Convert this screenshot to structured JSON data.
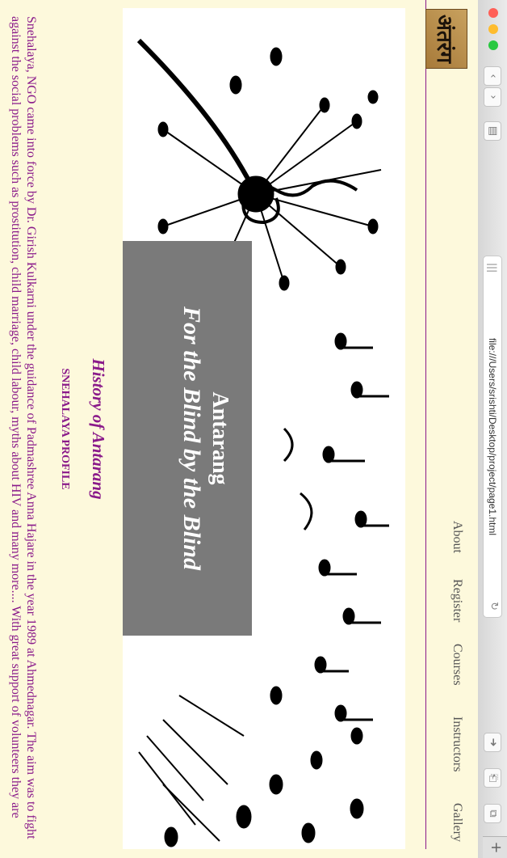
{
  "browser": {
    "url": "file:///Users/srishti/Desktop/project/page1.html",
    "new_tab_label": "+",
    "reader_icon": "reader-icon",
    "reload_icon": "reload-icon"
  },
  "nav": {
    "items": [
      "About",
      "Register",
      "Courses",
      "Instructors",
      "Gallery"
    ]
  },
  "hero": {
    "title": "Antarang",
    "subtitle": "For the Blind by the Blind"
  },
  "content": {
    "heading": "History of Antarang",
    "subheading": "SNEHALAYA PROFILE",
    "paragraph": "Snehalaya, NGO came into force by Dr. Girish Kulkarni under the guidance of Padmashree Anna Hajare in the year 1989 at Ahmednagar. The aim was to fight against the social problems such as prostitution, child marriage, child labour, myths about HIV and many more.... With great support of volunteers they are"
  },
  "colors": {
    "accent": "#8a1a8a",
    "background": "#fdf9dc"
  }
}
